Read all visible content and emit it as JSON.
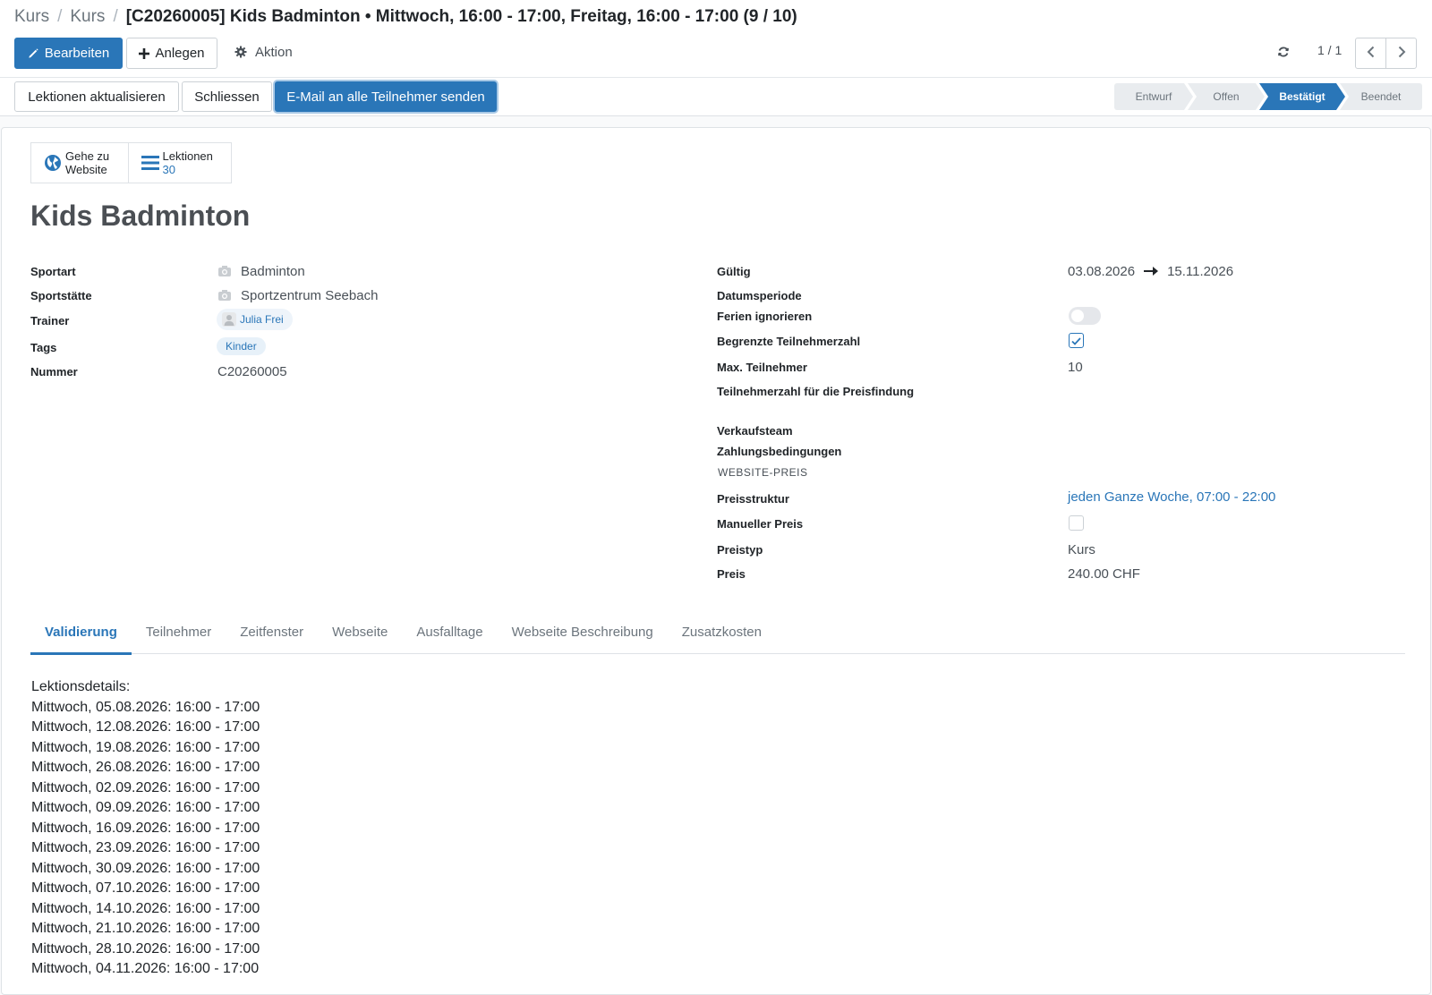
{
  "breadcrumb": {
    "items": [
      "Kurs",
      "Kurs"
    ],
    "current": "[C20260005] Kids Badminton • Mittwoch, 16:00 - 17:00, Freitag, 16:00 - 17:00 (9 / 10)"
  },
  "toolbar": {
    "edit_label": "Bearbeiten",
    "create_label": "Anlegen",
    "action_label": "Aktion",
    "pager": "1 / 1"
  },
  "header_buttons": {
    "update_lessons": "Lektionen aktualisieren",
    "close": "Schliessen",
    "email_all": "E-Mail an alle Teilnehmer senden"
  },
  "statusbar": {
    "stages": [
      "Entwurf",
      "Offen",
      "Bestätigt",
      "Beendet"
    ],
    "active": "Bestätigt"
  },
  "smart_buttons": {
    "website_line1": "Gehe zu",
    "website_line2": "Website",
    "lessons_label": "Lektionen",
    "lessons_count": "30"
  },
  "record": {
    "title": "Kids Badminton"
  },
  "left_fields": {
    "sport_label": "Sportart",
    "sport_value": "Badminton",
    "venue_label": "Sportstätte",
    "venue_value": "Sportzentrum Seebach",
    "trainer_label": "Trainer",
    "trainer_value": "Julia Frei",
    "tags_label": "Tags",
    "tags_value": "Kinder",
    "number_label": "Nummer",
    "number_value": "C20260005"
  },
  "right_fields": {
    "valid_label": "Gültig",
    "valid_from": "03.08.2026",
    "valid_to": "15.11.2026",
    "period_label": "Datumsperiode",
    "ignore_holidays_label": "Ferien ignorieren",
    "limited_label": "Begrenzte Teilnehmerzahl",
    "max_label": "Max. Teilnehmer",
    "max_value": "10",
    "pricing_count_label": "Teilnehmerzahl für die Preisfindung",
    "sales_team_label": "Verkaufsteam",
    "payment_terms_label": "Zahlungsbedingungen",
    "website_price_section": "WEBSITE-PREIS",
    "price_structure_label": "Preisstruktur",
    "price_structure_value": "jeden Ganze Woche, 07:00 - 22:00",
    "manual_price_label": "Manueller Preis",
    "price_type_label": "Preistyp",
    "price_type_value": "Kurs",
    "price_label": "Preis",
    "price_value": "240.00 CHF"
  },
  "states": {
    "ignore_holidays": false,
    "limited_participants": true,
    "manual_price": false
  },
  "tabs": [
    "Validierung",
    "Teilnehmer",
    "Zeitfenster",
    "Webseite",
    "Ausfalltage",
    "Webseite Beschreibung",
    "Zusatzkosten"
  ],
  "lessons": {
    "heading": "Lektionsdetails:",
    "items": [
      "Mittwoch, 05.08.2026: 16:00 - 17:00",
      "Mittwoch, 12.08.2026: 16:00 - 17:00",
      "Mittwoch, 19.08.2026: 16:00 - 17:00",
      "Mittwoch, 26.08.2026: 16:00 - 17:00",
      "Mittwoch, 02.09.2026: 16:00 - 17:00",
      "Mittwoch, 09.09.2026: 16:00 - 17:00",
      "Mittwoch, 16.09.2026: 16:00 - 17:00",
      "Mittwoch, 23.09.2026: 16:00 - 17:00",
      "Mittwoch, 30.09.2026: 16:00 - 17:00",
      "Mittwoch, 07.10.2026: 16:00 - 17:00",
      "Mittwoch, 14.10.2026: 16:00 - 17:00",
      "Mittwoch, 21.10.2026: 16:00 - 17:00",
      "Mittwoch, 28.10.2026: 16:00 - 17:00",
      "Mittwoch, 04.11.2026: 16:00 - 17:00"
    ]
  },
  "icons": {
    "edit": "pencil-icon",
    "create": "plus-icon",
    "action": "gear-icon",
    "refresh": "refresh-icon",
    "prev": "chevron-left-icon",
    "next": "chevron-right-icon",
    "website": "globe-icon",
    "lessons": "list-icon",
    "sport": "camera-icon",
    "venue": "camera-icon",
    "trainer": "user-avatar-icon",
    "arrow": "arrow-right-icon"
  },
  "colors": {
    "primary": "#2a76b8",
    "text": "#212529",
    "muted": "#6c757d"
  }
}
